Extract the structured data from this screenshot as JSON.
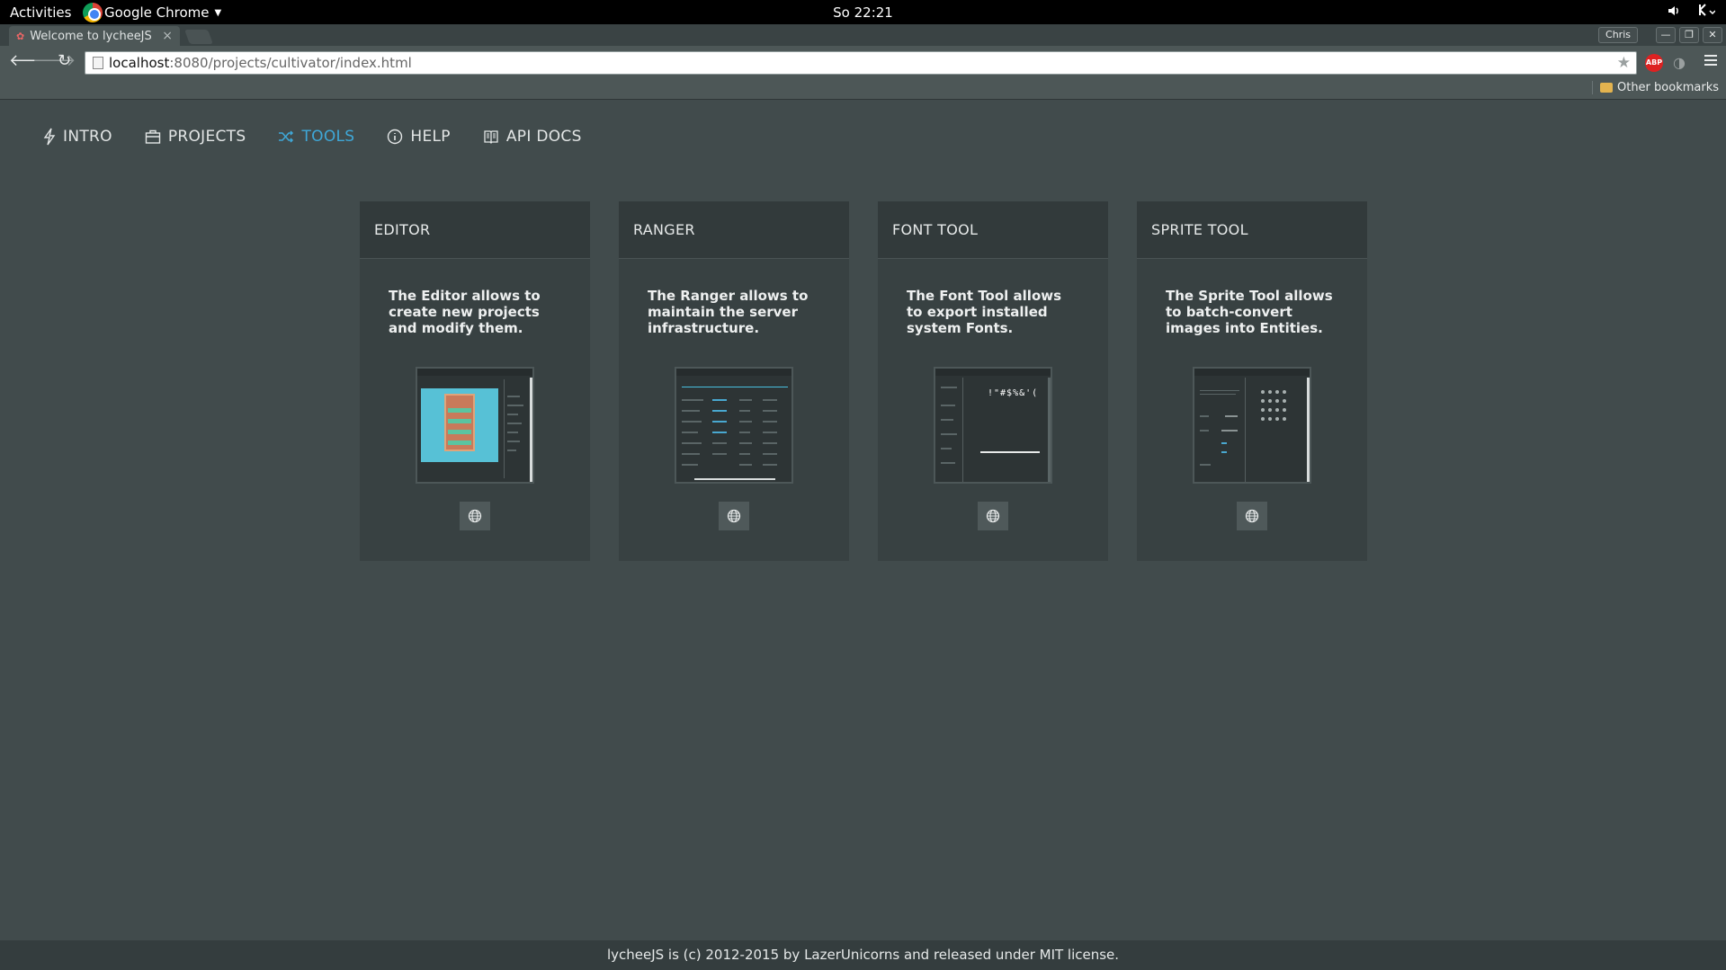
{
  "desktop": {
    "activities": "Activities",
    "app_name": "Google Chrome",
    "clock": "So 22:21"
  },
  "browser": {
    "tab_title": "Welcome to lycheeJS",
    "profile": "Chris",
    "url_host": "localhost",
    "url_path": ":8080/projects/cultivator/index.html",
    "bookmark": "Other bookmarks",
    "abp_label": "ABP"
  },
  "nav": {
    "items": [
      {
        "label": "INTRO",
        "icon": "lightning-icon"
      },
      {
        "label": "PROJECTS",
        "icon": "briefcase-icon"
      },
      {
        "label": "TOOLS",
        "icon": "shuffle-icon",
        "active": true
      },
      {
        "label": "HELP",
        "icon": "info-icon"
      },
      {
        "label": "API DOCS",
        "icon": "book-icon"
      }
    ],
    "active_color": "#3fa8d8"
  },
  "cards": [
    {
      "title": "EDITOR",
      "description": "The Editor allows to create new projects and modify them."
    },
    {
      "title": "RANGER",
      "description": "The Ranger allows to maintain the server infrastructure."
    },
    {
      "title": "FONT TOOL",
      "description": "The Font Tool allows to export installed system Fonts."
    },
    {
      "title": "SPRITE TOOL",
      "description": "The Sprite Tool allows to batch-convert images into Entities."
    }
  ],
  "thumb_text": {
    "font_glyphs": "!\"#$%&'("
  },
  "footer": {
    "text": "lycheeJS is (c) 2012-2015 by LazerUnicorns and released under MIT license."
  }
}
